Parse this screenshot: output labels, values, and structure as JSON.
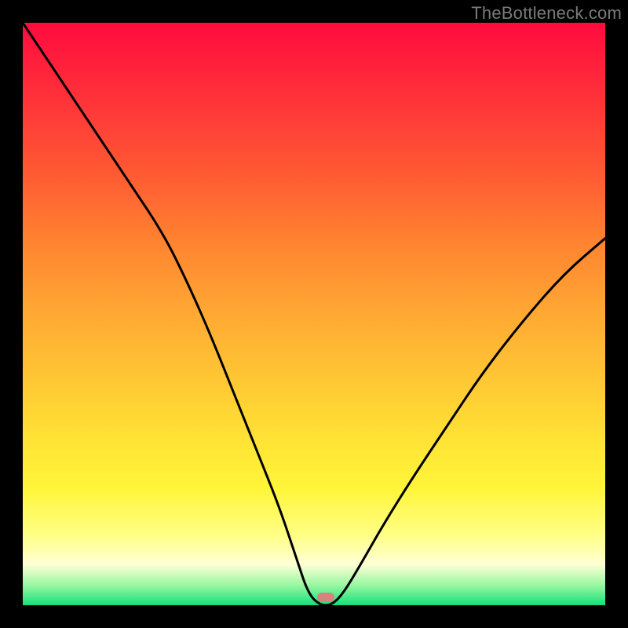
{
  "watermark": "TheBottleneck.com",
  "marker": {
    "x_frac": 0.52,
    "y_frac": 0.987
  },
  "chart_data": {
    "type": "line",
    "title": "",
    "xlabel": "",
    "ylabel": "",
    "xlim": [
      0,
      100
    ],
    "ylim": [
      0,
      100
    ],
    "series": [
      {
        "name": "bottleneck-curve",
        "x": [
          0,
          6,
          12,
          18,
          24,
          28,
          32,
          36,
          40,
          44,
          47,
          49,
          51,
          53,
          55,
          58,
          62,
          67,
          73,
          79,
          86,
          93,
          100
        ],
        "y": [
          100,
          91,
          82,
          73,
          64,
          56,
          47,
          37,
          27,
          17,
          8,
          2,
          0,
          0,
          2,
          7,
          14,
          22,
          31,
          40,
          49,
          57,
          63
        ]
      }
    ],
    "annotations": [
      {
        "type": "marker",
        "x": 52,
        "y": 0.7,
        "label": "optimal-point"
      }
    ],
    "background_gradient": {
      "type": "vertical",
      "stops": [
        {
          "pos": 0.0,
          "color": "#ff0b3e"
        },
        {
          "pos": 0.5,
          "color": "#ffa933"
        },
        {
          "pos": 0.8,
          "color": "#fff53a"
        },
        {
          "pos": 1.0,
          "color": "#15e07a"
        }
      ]
    }
  }
}
